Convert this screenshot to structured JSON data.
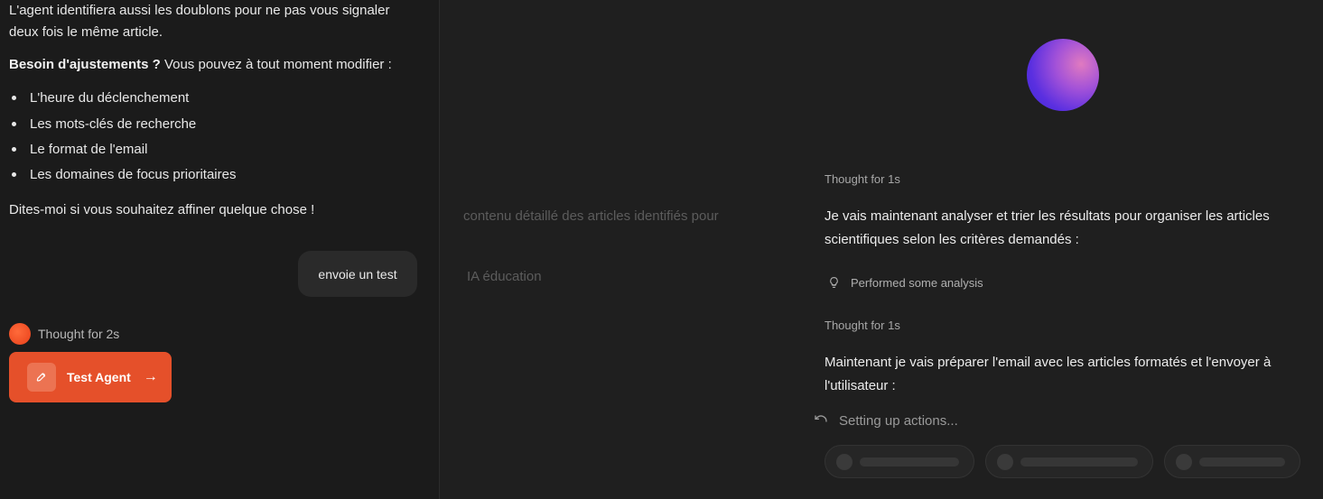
{
  "left": {
    "para1": "L'agent identifiera aussi les doublons pour ne pas vous signaler",
    "para1b": "deux fois le même article.",
    "adjust_bold": "Besoin d'ajustements ?",
    "adjust_rest": " Vous pouvez à tout moment modifier :",
    "bullets": [
      "L'heure du déclenchement",
      "Les mots-clés de recherche",
      "Le format de l'email",
      "Les domaines de focus prioritaires"
    ],
    "closing": "Dites-moi si vous souhaitez affiner quelque chose !",
    "user_message": "envoie un test",
    "thought_label": "Thought for 2s",
    "test_button": "Test Agent",
    "arrow": "→"
  },
  "right": {
    "ghost1": "contenu détaillé des articles identifiés pour",
    "ghost2": "IA éducation",
    "thought1": "Thought for 1s",
    "msg1": "Je vais maintenant analyser et trier les résultats pour organiser les articles scientifiques selon les critères demandés :",
    "analysis": "Performed some analysis",
    "thought2": "Thought for 1s",
    "msg2": "Maintenant je vais préparer l'email avec les articles formatés et l'envoyer à l'utilisateur :",
    "setting_up": "Setting up actions..."
  },
  "icons": [
    "rocket-icon",
    "arrow-right-icon",
    "lightbulb-icon",
    "spinner-icon",
    "orb-avatar"
  ],
  "colors": {
    "accent": "#e5502a",
    "background": "#1b1b1b"
  }
}
